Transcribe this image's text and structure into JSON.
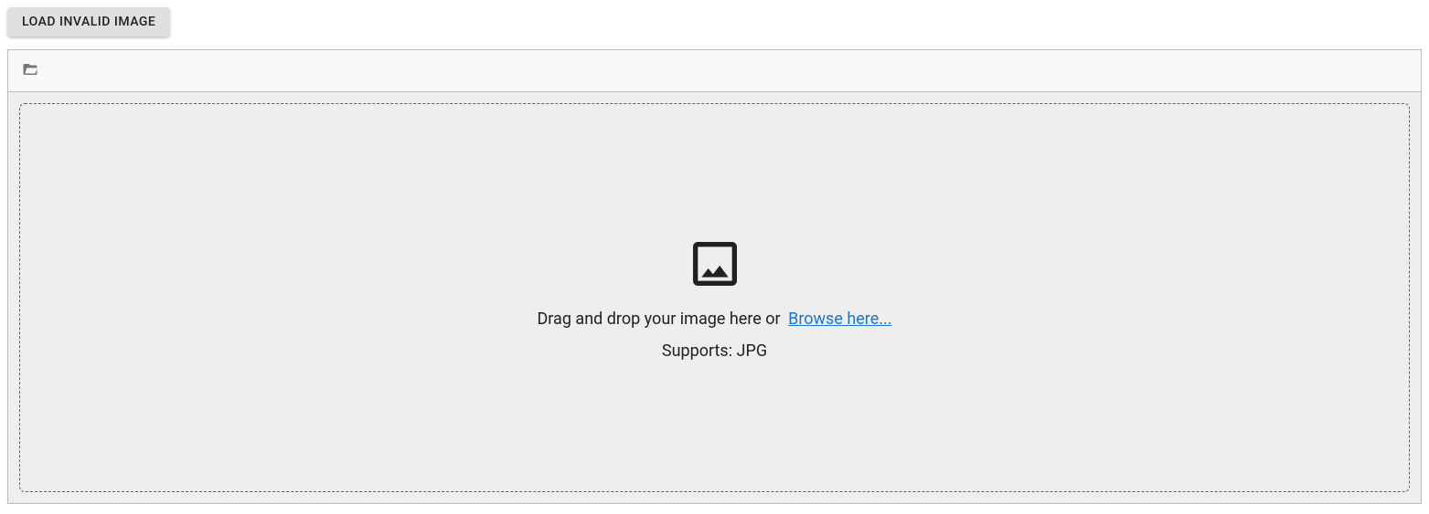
{
  "toolbar": {
    "load_invalid_label": "LOAD INVALID IMAGE"
  },
  "uploader": {
    "icons": {
      "folder_open": "folder-open-icon",
      "image": "image-icon"
    },
    "dropzone": {
      "instruction_prefix": "Drag and drop your image here or ",
      "browse_label": "Browse here...",
      "supports_label": "Supports: JPG"
    }
  }
}
